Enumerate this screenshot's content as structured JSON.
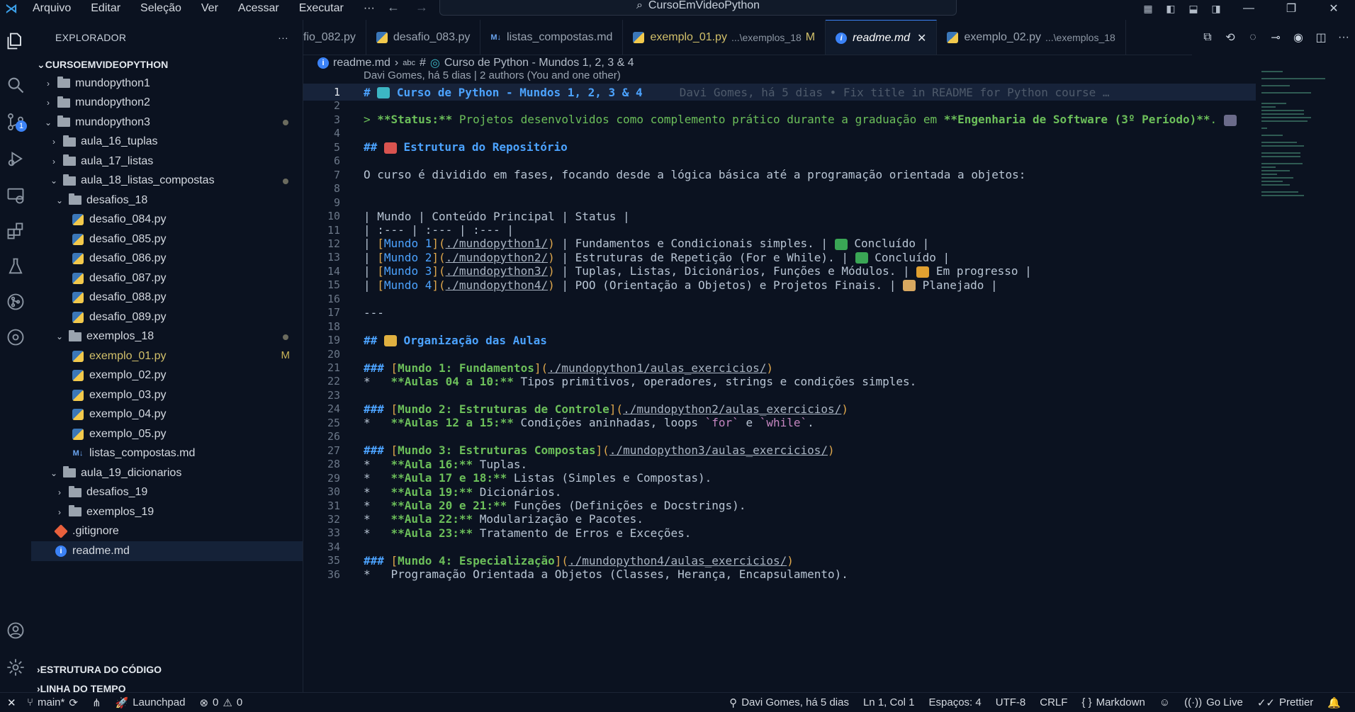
{
  "titlebar": {
    "menu": [
      "Arquivo",
      "Editar",
      "Seleção",
      "Ver",
      "Acessar",
      "Executar",
      "···"
    ],
    "search": "CursoEmVideoPython"
  },
  "activity": {
    "scm_badge": "1"
  },
  "explorer": {
    "title": "EXPLORADOR",
    "more": "···",
    "root": "CURSOEMVIDEOPYTHON",
    "tree": [
      {
        "label": "mundopython1",
        "type": "folder",
        "depth": 1,
        "open": false
      },
      {
        "label": "mundopython2",
        "type": "folder",
        "depth": 1,
        "open": false
      },
      {
        "label": "mundopython3",
        "type": "folder",
        "depth": 1,
        "open": true,
        "dot": true
      },
      {
        "label": "aula_16_tuplas",
        "type": "folder",
        "depth": 2,
        "open": false
      },
      {
        "label": "aula_17_listas",
        "type": "folder",
        "depth": 2,
        "open": false
      },
      {
        "label": "aula_18_listas_compostas",
        "type": "folder",
        "depth": 2,
        "open": true,
        "dot": true
      },
      {
        "label": "desafios_18",
        "type": "folder",
        "depth": 3,
        "open": true
      },
      {
        "label": "desafio_084.py",
        "type": "py",
        "depth": 4
      },
      {
        "label": "desafio_085.py",
        "type": "py",
        "depth": 4
      },
      {
        "label": "desafio_086.py",
        "type": "py",
        "depth": 4
      },
      {
        "label": "desafio_087.py",
        "type": "py",
        "depth": 4
      },
      {
        "label": "desafio_088.py",
        "type": "py",
        "depth": 4
      },
      {
        "label": "desafio_089.py",
        "type": "py",
        "depth": 4
      },
      {
        "label": "exemplos_18",
        "type": "folder",
        "depth": 3,
        "open": true,
        "dot": true
      },
      {
        "label": "exemplo_01.py",
        "type": "py",
        "depth": 4,
        "flag": "M"
      },
      {
        "label": "exemplo_02.py",
        "type": "py",
        "depth": 4
      },
      {
        "label": "exemplo_03.py",
        "type": "py",
        "depth": 4
      },
      {
        "label": "exemplo_04.py",
        "type": "py",
        "depth": 4
      },
      {
        "label": "exemplo_05.py",
        "type": "py",
        "depth": 4
      },
      {
        "label": "listas_compostas.md",
        "type": "md",
        "depth": 4
      },
      {
        "label": "aula_19_dicionarios",
        "type": "folder",
        "depth": 2,
        "open": true
      },
      {
        "label": "desafios_19",
        "type": "folder",
        "depth": 3,
        "open": false
      },
      {
        "label": "exemplos_19",
        "type": "folder",
        "depth": 3,
        "open": false
      },
      {
        "label": ".gitignore",
        "type": "git",
        "depth": 1
      },
      {
        "label": "readme.md",
        "type": "info",
        "depth": 1,
        "active": true
      }
    ],
    "outline": "ESTRUTURA DO CÓDIGO",
    "timeline": "LINHA DO TEMPO"
  },
  "tabs": [
    {
      "name": "fio_082.py",
      "icon": "py"
    },
    {
      "name": "desafio_083.py",
      "icon": "py"
    },
    {
      "name": "listas_compostas.md",
      "icon": "md"
    },
    {
      "name": "exemplo_01.py",
      "icon": "py",
      "desc": "...\\exemplos_18",
      "mod": "M"
    },
    {
      "name": "readme.md",
      "icon": "info",
      "active": true,
      "close": "✕"
    },
    {
      "name": "exemplo_02.py",
      "icon": "py",
      "desc": "...\\exemplos_18"
    }
  ],
  "breadcrumb": {
    "file": "readme.md",
    "sep": "›",
    "symbol": "#",
    "heading": "Curso de Python - Mundos 1, 2, 3 & 4"
  },
  "blame_header": "Davi Gomes, há 5 dias | 2 authors (You and one other)",
  "editor": {
    "current_line": 1,
    "ghost_blame": "Davi Gomes, há 5 dias • Fix title in README for Python course …",
    "lines": [
      [
        [
          "h",
          "# "
        ],
        [
          "emoji",
          "#3cb6c4"
        ],
        [
          "h",
          " Curso de Python - Mundos 1, 2, 3 & 4"
        ]
      ],
      [],
      [
        [
          "q",
          "> "
        ],
        [
          "b",
          "**Status:**"
        ],
        [
          "q",
          " Projetos desenvolvidos como complemento prático durante a graduação em "
        ],
        [
          "b",
          "**Engenharia de Software (3º Período)**"
        ],
        [
          "q",
          ". "
        ],
        [
          "emoji",
          "#6b6b8a"
        ]
      ],
      [],
      [
        [
          "h",
          "## "
        ],
        [
          "emoji",
          "#d9534f"
        ],
        [
          "h",
          " Estrutura do Repositório"
        ]
      ],
      [],
      [
        [
          "t",
          "O curso é dividido em fases, focando desde a lógica básica até a programação orientada a objetos:"
        ]
      ],
      [],
      [],
      [
        [
          "t",
          "| Mundo | Conteúdo Principal | Status |"
        ]
      ],
      [
        [
          "t",
          "| :--- | :--- | :--- |"
        ]
      ],
      [
        [
          "t",
          "| "
        ],
        [
          "lb",
          "["
        ],
        [
          "link",
          "Mundo 1"
        ],
        [
          "lb",
          "]("
        ],
        [
          "url",
          "./mundopython1/"
        ],
        [
          "lb",
          ")"
        ],
        [
          "t",
          " | Fundamentos e Condicionais simples. | "
        ],
        [
          "emoji",
          "#3aa655"
        ],
        [
          "t",
          " Concluído |"
        ]
      ],
      [
        [
          "t",
          "| "
        ],
        [
          "lb",
          "["
        ],
        [
          "link",
          "Mundo 2"
        ],
        [
          "lb",
          "]("
        ],
        [
          "url",
          "./mundopython2/"
        ],
        [
          "lb",
          ")"
        ],
        [
          "t",
          " | Estruturas de Repetição (For e While). | "
        ],
        [
          "emoji",
          "#3aa655"
        ],
        [
          "t",
          " Concluído |"
        ]
      ],
      [
        [
          "t",
          "| "
        ],
        [
          "lb",
          "["
        ],
        [
          "link",
          "Mundo 3"
        ],
        [
          "lb",
          "]("
        ],
        [
          "url",
          "./mundopython3/"
        ],
        [
          "lb",
          ")"
        ],
        [
          "t",
          " | Tuplas, Listas, Dicionários, Funções e Módulos. | "
        ],
        [
          "emoji",
          "#e0a030"
        ],
        [
          "t",
          " Em progresso |"
        ]
      ],
      [
        [
          "t",
          "| "
        ],
        [
          "lb",
          "["
        ],
        [
          "link",
          "Mundo 4"
        ],
        [
          "lb",
          "]("
        ],
        [
          "url",
          "./mundopython4/"
        ],
        [
          "lb",
          ")"
        ],
        [
          "t",
          " | POO (Orientação a Objetos) e Projetos Finais. | "
        ],
        [
          "emoji",
          "#d8a860"
        ],
        [
          "t",
          " Planejado |"
        ]
      ],
      [],
      [
        [
          "t",
          "---"
        ]
      ],
      [],
      [
        [
          "h",
          "## "
        ],
        [
          "emoji",
          "#e0b040"
        ],
        [
          "h",
          " Organização das Aulas"
        ]
      ],
      [],
      [
        [
          "h",
          "### "
        ],
        [
          "lb",
          "["
        ],
        [
          "b",
          "Mundo 1: Fundamentos"
        ],
        [
          "lb",
          "]("
        ],
        [
          "url",
          "./mundopython1/aulas_exercicios/"
        ],
        [
          "lb",
          ")"
        ]
      ],
      [
        [
          "t",
          "*   "
        ],
        [
          "b",
          "**Aulas 04 a 10:**"
        ],
        [
          "t",
          " Tipos primitivos, operadores, strings e condições simples."
        ]
      ],
      [],
      [
        [
          "h",
          "### "
        ],
        [
          "lb",
          "["
        ],
        [
          "b",
          "Mundo 2: Estruturas de Controle"
        ],
        [
          "lb",
          "]("
        ],
        [
          "url",
          "./mundopython2/aulas_exercicios/"
        ],
        [
          "lb",
          ")"
        ]
      ],
      [
        [
          "t",
          "*   "
        ],
        [
          "b",
          "**Aulas 12 a 15:**"
        ],
        [
          "t",
          " Condições aninhadas, loops "
        ],
        [
          "code",
          "`for`"
        ],
        [
          "t",
          " e "
        ],
        [
          "code",
          "`while`"
        ],
        [
          "t",
          "."
        ]
      ],
      [],
      [
        [
          "h",
          "### "
        ],
        [
          "lb",
          "["
        ],
        [
          "b",
          "Mundo 3: Estruturas Compostas"
        ],
        [
          "lb",
          "]("
        ],
        [
          "url",
          "./mundopython3/aulas_exercicios/"
        ],
        [
          "lb",
          ")"
        ]
      ],
      [
        [
          "t",
          "*   "
        ],
        [
          "b",
          "**Aula 16:**"
        ],
        [
          "t",
          " Tuplas."
        ]
      ],
      [
        [
          "t",
          "*   "
        ],
        [
          "b",
          "**Aula 17 e 18:**"
        ],
        [
          "t",
          " Listas (Simples e Compostas)."
        ]
      ],
      [
        [
          "t",
          "*   "
        ],
        [
          "b",
          "**Aula 19:**"
        ],
        [
          "t",
          " Dicionários."
        ]
      ],
      [
        [
          "t",
          "*   "
        ],
        [
          "b",
          "**Aula 20 e 21:**"
        ],
        [
          "t",
          " Funções (Definições e Docstrings)."
        ]
      ],
      [
        [
          "t",
          "*   "
        ],
        [
          "b",
          "**Aula 22:**"
        ],
        [
          "t",
          " Modularização e Pacotes."
        ]
      ],
      [
        [
          "t",
          "*   "
        ],
        [
          "b",
          "**Aula 23:**"
        ],
        [
          "t",
          " Tratamento de Erros e Exceções."
        ]
      ],
      [],
      [
        [
          "h",
          "### "
        ],
        [
          "lb",
          "["
        ],
        [
          "b",
          "Mundo 4: Especialização"
        ],
        [
          "lb",
          "]("
        ],
        [
          "url",
          "./mundopython4/aulas_exercicios/"
        ],
        [
          "lb",
          ")"
        ]
      ],
      [
        [
          "t",
          "*   Programação Orientada a Objetos (Classes, Herança, Encapsulamento)."
        ]
      ]
    ]
  },
  "statusbar": {
    "remote": "✕",
    "branch": "main*",
    "launchpad": "Launchpad",
    "errors": "0",
    "warnings": "0",
    "blame": "Davi Gomes, há 5 dias",
    "position": "Ln 1, Col 1",
    "spaces": "Espaços: 4",
    "encoding": "UTF-8",
    "eol": "CRLF",
    "language": "Markdown",
    "golive": "Go Live",
    "prettier": "Prettier"
  }
}
